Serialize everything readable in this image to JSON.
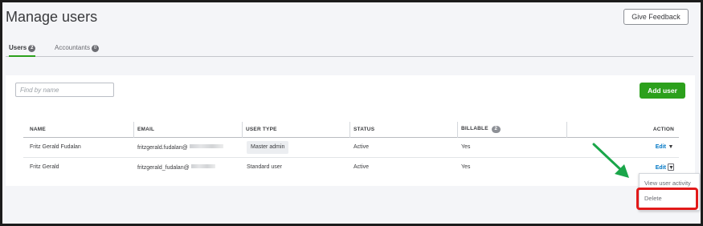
{
  "header": {
    "title": "Manage users",
    "feedback_label": "Give Feedback"
  },
  "tabs": [
    {
      "label": "Users",
      "count": "2",
      "active": true
    },
    {
      "label": "Accountants",
      "count": "0",
      "active": false
    }
  ],
  "search": {
    "placeholder": "Find by name",
    "value": ""
  },
  "add_user_label": "Add user",
  "table": {
    "columns": {
      "name": "NAME",
      "email": "EMAIL",
      "user_type": "USER TYPE",
      "status": "STATUS",
      "billable": "BILLABLE",
      "billable_count": "2",
      "action": "ACTION"
    },
    "rows": [
      {
        "name": "Fritz Gerald Fudalan",
        "email": "fritzgerald.fudalan@",
        "user_type": "Master admin",
        "status": "Active",
        "billable": "Yes",
        "action": "Edit"
      },
      {
        "name": "Fritz Gerald",
        "email": "fritzgerald_fudalan@",
        "user_type": "Standard user",
        "status": "Active",
        "billable": "Yes",
        "action": "Edit"
      }
    ]
  },
  "action_menu": {
    "items": [
      "View user activity",
      "Delete"
    ]
  },
  "icons": {
    "caret": "caret-down-icon",
    "annotation_arrow": "arrow-icon"
  },
  "colors": {
    "accent": "#2ca01c",
    "link": "#0077c5",
    "highlight": "#e21a1a",
    "arrow": "#1aa64a"
  }
}
